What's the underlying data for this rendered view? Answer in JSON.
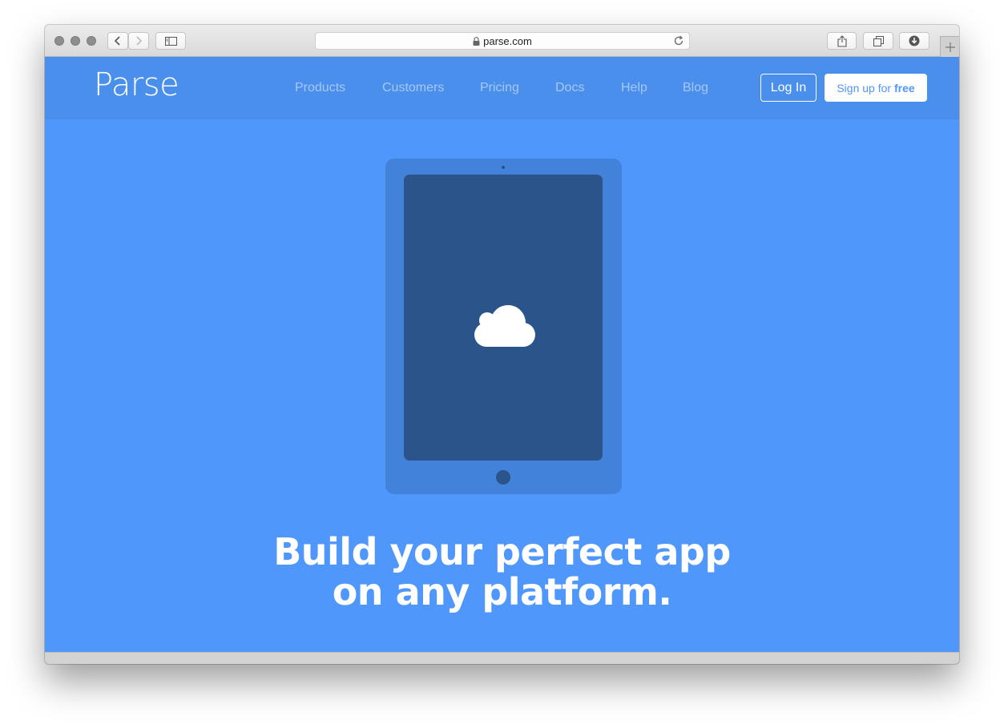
{
  "browser": {
    "url": "parse.com",
    "icons": {
      "close": "close-dot",
      "minimize": "minimize-dot",
      "zoom": "zoom-dot",
      "back": "chevron-left-icon",
      "forward": "chevron-right-icon",
      "sidebar": "sidebar-icon",
      "lock": "lock-icon",
      "reload": "reload-icon",
      "share": "share-icon",
      "tabs": "tabs-icon",
      "downloads": "download-icon",
      "new_tab": "plus-icon"
    }
  },
  "nav": {
    "logo": "Parse",
    "links": [
      "Products",
      "Customers",
      "Pricing",
      "Docs",
      "Help",
      "Blog"
    ],
    "login": "Log In",
    "signup_prefix": "Sign up for ",
    "signup_bold": "free"
  },
  "hero": {
    "icon": "cloud-icon",
    "headline_line1": "Build your perfect app",
    "headline_line2": "on any platform."
  },
  "colors": {
    "page_bg": "#4f97fb",
    "nav_bg": "#4a8fec",
    "tablet_body": "#4282db",
    "tablet_screen": "#2b548b"
  }
}
